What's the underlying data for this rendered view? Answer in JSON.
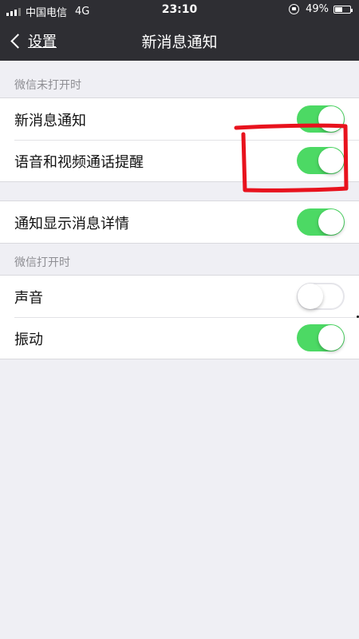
{
  "status_bar": {
    "carrier": "中国电信",
    "network": "4G",
    "time": "23:10",
    "battery": "49%",
    "battery_level": 0.49
  },
  "nav": {
    "back_label": "设置",
    "title": "新消息通知"
  },
  "sections": {
    "closed_header": "微信未打开时",
    "open_header": "微信打开时"
  },
  "group1": {
    "rows": [
      {
        "label": "新消息通知",
        "on": true
      },
      {
        "label": "语音和视频通话提醒",
        "on": true
      }
    ]
  },
  "group2": {
    "rows": [
      {
        "label": "通知显示消息详情",
        "on": true
      }
    ]
  },
  "group3": {
    "rows": [
      {
        "label": "声音",
        "on": false
      },
      {
        "label": "振动",
        "on": true
      }
    ]
  },
  "colors": {
    "switch_on": "#4cd964",
    "annotation": "#e8121d",
    "bar_background": "#2e2e33"
  }
}
